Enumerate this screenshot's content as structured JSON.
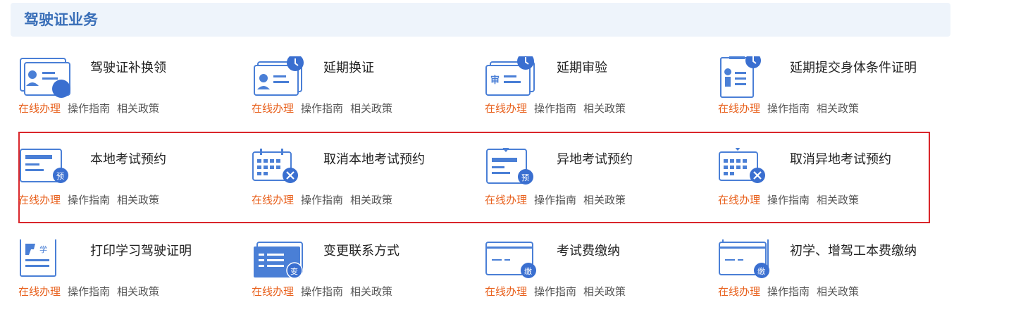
{
  "header": {
    "title": "驾驶证业务"
  },
  "link_labels": {
    "online": "在线办理",
    "guide": "操作指南",
    "policy": "相关政策"
  },
  "services": [
    {
      "title": "驾驶证补换领",
      "icon": "license-replace-icon"
    },
    {
      "title": "延期换证",
      "icon": "license-extend-icon"
    },
    {
      "title": "延期审验",
      "icon": "review-extend-icon"
    },
    {
      "title": "延期提交身体条件证明",
      "icon": "health-cert-extend-icon"
    },
    {
      "title": "本地考试预约",
      "icon": "local-exam-booking-icon"
    },
    {
      "title": "取消本地考试预约",
      "icon": "cancel-local-booking-icon"
    },
    {
      "title": "异地考试预约",
      "icon": "remote-exam-booking-icon"
    },
    {
      "title": "取消异地考试预约",
      "icon": "cancel-remote-booking-icon"
    },
    {
      "title": "打印学习驾驶证明",
      "icon": "print-learner-cert-icon"
    },
    {
      "title": "变更联系方式",
      "icon": "change-contact-icon"
    },
    {
      "title": "考试费缴纳",
      "icon": "exam-fee-payment-icon"
    },
    {
      "title": "初学、增驾工本费缴纳",
      "icon": "license-fee-payment-icon"
    }
  ],
  "badges": {
    "booking": "预",
    "change": "变",
    "payment": "缴",
    "learner": "学",
    "review": "审"
  },
  "colors": {
    "accent_blue": "#3a6fb8",
    "icon_blue": "#4a7fd6",
    "online_orange": "#e8601c",
    "highlight_red": "#d9262b"
  }
}
